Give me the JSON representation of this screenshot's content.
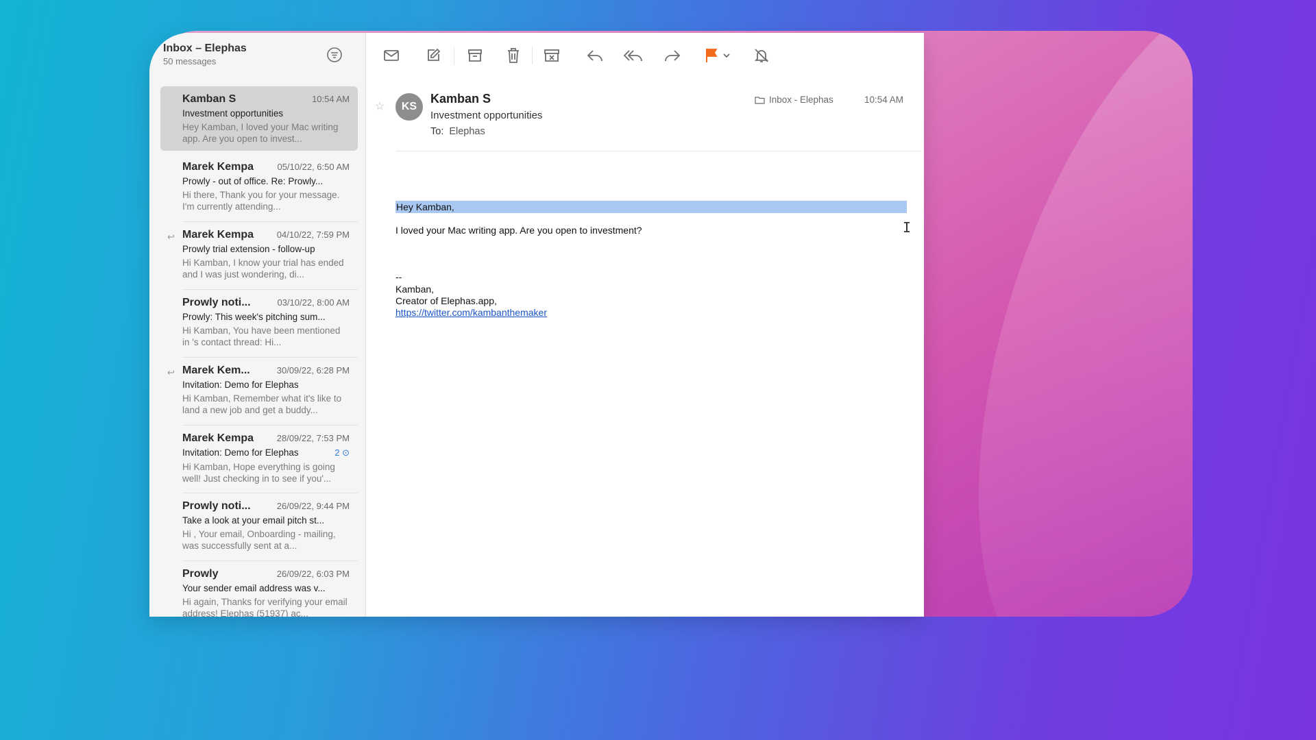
{
  "mailbox": {
    "title": "Inbox – Elephas",
    "count": "50 messages"
  },
  "messages": [
    {
      "sender": "Kamban S",
      "time": "10:54 AM",
      "subject": "Investment opportunities",
      "preview": "Hey Kamban, I loved your Mac writing app. Are you open to invest...",
      "selected": true,
      "replied": false
    },
    {
      "sender": "Marek Kempa",
      "time": "05/10/22, 6:50 AM",
      "subject": "Prowly - out of office. Re: Prowly...",
      "preview": "Hi there, Thank you for your message.  I'm currently attending...",
      "replied": false
    },
    {
      "sender": "Marek Kempa",
      "time": "04/10/22, 7:59 PM",
      "subject": "Prowly trial extension - follow-up",
      "preview": "Hi Kamban, I know your trial has ended and I was just wondering, di...",
      "replied": true
    },
    {
      "sender": "Prowly noti...",
      "time": "03/10/22, 8:00 AM",
      "subject": "Prowly: This week's pitching sum...",
      "preview": "Hi Kamban, You have been mentioned in 's contact thread: Hi...",
      "replied": false
    },
    {
      "sender": "Marek Kem...",
      "time": "30/09/22, 6:28 PM",
      "subject": "Invitation: Demo for Elephas",
      "preview": "Hi Kamban, Remember what it's like to land a new job and get a buddy...",
      "replied": true
    },
    {
      "sender": "Marek Kempa",
      "time": "28/09/22, 7:53 PM",
      "subject": "Invitation: Demo for Elephas",
      "thread_count": "2",
      "preview": "Hi Kamban, Hope everything is going well! Just checking in to see if you'...",
      "replied": false
    },
    {
      "sender": "Prowly noti...",
      "time": "26/09/22, 9:44 PM",
      "subject": "Take a look at your email pitch st...",
      "preview": "Hi , Your email, Onboarding - mailing, was successfully sent at a...",
      "replied": false
    },
    {
      "sender": "Prowly",
      "time": "26/09/22, 6:03 PM",
      "subject": "Your sender email address was v...",
      "preview": "Hi again, Thanks for verifying your email address! Elephas (51937) ac...",
      "replied": false
    }
  ],
  "toolbar": {
    "icons": [
      "envelope-icon",
      "compose-icon",
      "archive-icon",
      "trash-icon",
      "junk-icon",
      "reply-icon",
      "reply-all-icon",
      "forward-icon",
      "flag-icon",
      "chevron-down-icon",
      "mute-bell-icon",
      "more-chevrons-icon",
      "search-icon"
    ],
    "flag_color": "#f26b1d"
  },
  "message_view": {
    "avatar_initials": "KS",
    "sender": "Kamban S",
    "subject": "Investment opportunities",
    "to_label": "To:",
    "to": "Elephas",
    "mailbox": "Inbox - Elephas",
    "time": "10:54 AM",
    "body": {
      "greeting": "Hey Kamban,",
      "line1": "I loved your Mac writing app. Are you open to investment?",
      "sig_dash": "--",
      "sig_name": "Kamban,",
      "sig_title": "Creator of Elephas.app,",
      "sig_link": "https://twitter.com/kambanthemaker"
    }
  },
  "colors": {
    "accent": "#2f7bdc",
    "selection": "#a9c8f2",
    "selected_row": "#d4d3d3"
  }
}
